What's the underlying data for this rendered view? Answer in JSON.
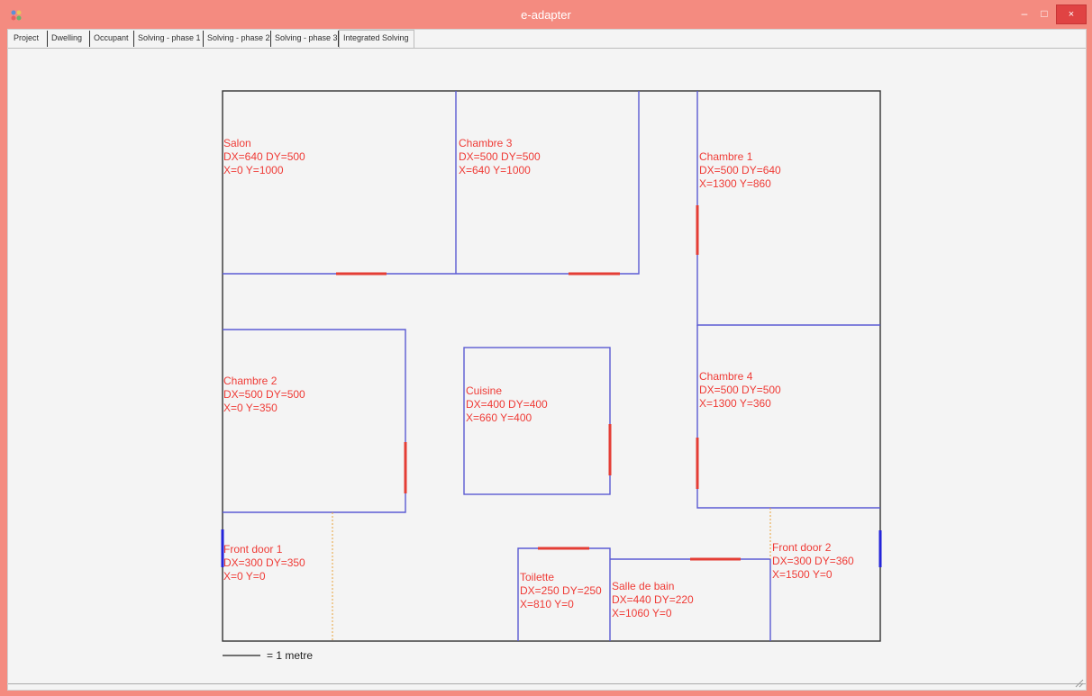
{
  "window": {
    "title": "e-adapter",
    "minimize_glyph": "–",
    "maximize_glyph": "□",
    "close_glyph": "×"
  },
  "tabs": [
    {
      "label": "Project"
    },
    {
      "label": "Dwelling"
    },
    {
      "label": "Occupant"
    },
    {
      "label": "Solving - phase 1"
    },
    {
      "label": "Solving - phase 2"
    },
    {
      "label": "Solving - phase 3"
    },
    {
      "label": "Integrated Solving",
      "active": true
    }
  ],
  "rooms": [
    {
      "id": "salon",
      "label": "Salon\nDX=640 DY=500\nX=0 Y=1000"
    },
    {
      "id": "chambre-3",
      "label": "Chambre 3\nDX=500 DY=500\nX=640 Y=1000"
    },
    {
      "id": "chambre-1",
      "label": "Chambre 1\nDX=500 DY=640\nX=1300 Y=860"
    },
    {
      "id": "chambre-2",
      "label": "Chambre 2\nDX=500 DY=500\nX=0 Y=350"
    },
    {
      "id": "cuisine",
      "label": "Cuisine\nDX=400 DY=400\nX=660 Y=400"
    },
    {
      "id": "chambre-4",
      "label": "Chambre 4\nDX=500 DY=500\nX=1300 Y=360"
    },
    {
      "id": "front-door-1",
      "label": "Front door 1\nDX=300 DY=350\nX=0 Y=0"
    },
    {
      "id": "toilette",
      "label": "Toilette\nDX=250 DY=250\nX=810 Y=0"
    },
    {
      "id": "salle-de-bain",
      "label": "Salle de bain\nDX=440 DY=220\nX=1060 Y=0"
    },
    {
      "id": "front-door-2",
      "label": "Front door 2\nDX=300 DY=360\nX=1500 Y=0"
    }
  ],
  "scale": {
    "label": "= 1 metre"
  },
  "colors": {
    "wall": "#5b5bd3",
    "outer_wall": "#333333",
    "door": "#e43d35",
    "entrance": "#2424d9",
    "divider": "#e7a23a",
    "label": "#ef3b36"
  }
}
